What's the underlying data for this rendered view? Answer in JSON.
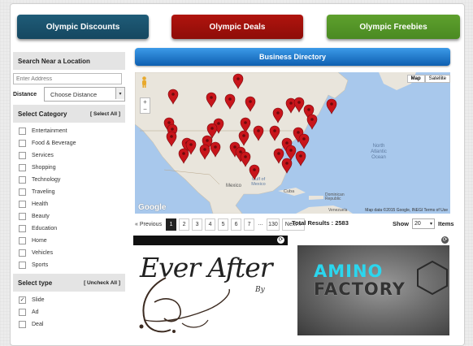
{
  "top_buttons": {
    "discounts": "Olympic Discounts",
    "deals": "Olympic Deals",
    "freebies": "Olympic Freebies"
  },
  "colors": {
    "discounts": "#1a5370",
    "deals": "#9e110b",
    "freebies": "#559a28",
    "directory": "#1a72c8"
  },
  "sidebar": {
    "location_heading": "Search Near a Location",
    "address_placeholder": "Enter Address",
    "distance_label": "Distance",
    "distance_value": "Choose Distance",
    "category_heading": "Select Category",
    "select_all": "[ Select All ]",
    "categories": [
      "Entertainment",
      "Food & Beverage",
      "Services",
      "Shopping",
      "Technology",
      "Traveling",
      "Health",
      "Beauty",
      "Education",
      "Home",
      "Vehicles",
      "Sports"
    ],
    "type_heading": "Select type",
    "uncheck_all": "[ Uncheck All ]",
    "types": [
      {
        "label": "Slide",
        "checked": true
      },
      {
        "label": "Ad",
        "checked": false
      },
      {
        "label": "Deal",
        "checked": false
      }
    ]
  },
  "directory_title": "Business Directory",
  "map": {
    "type_map": "Map",
    "type_satellite": "Satellite",
    "labels": {
      "north_atlantic": "North\nAtlantic\nOcean",
      "gulf": "Gulf of\nMexico",
      "mexico": "Mexico",
      "cuba": "Cuba",
      "dominican": "Dominican\nRepublic",
      "venezuela": "Venezuela"
    },
    "attribution": "Map data ©2015 Google, INEGI   Terms of Use",
    "google": "Google"
  },
  "pagination": {
    "previous": "« Previous",
    "pages": [
      "1",
      "2",
      "3",
      "4",
      "5",
      "6",
      "7",
      "...",
      "130"
    ],
    "next": "Next »",
    "active_page": "1"
  },
  "results": {
    "total_label": "Total Results : 2583",
    "show_label": "Show",
    "show_value": "20",
    "items_label": "Items"
  },
  "cards": [
    {
      "title": "Ever After",
      "by": "By"
    },
    {
      "line1": "AMINO",
      "line2": "FACTORY"
    }
  ]
}
